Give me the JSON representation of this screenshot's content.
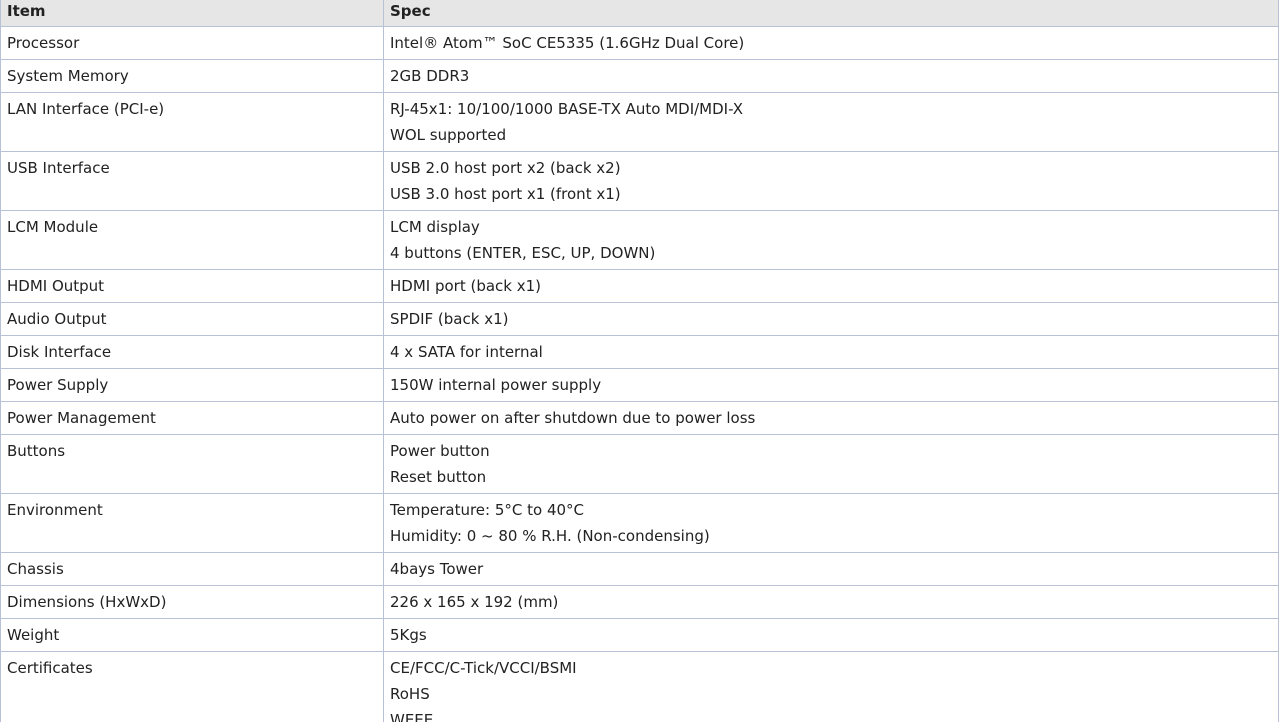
{
  "table": {
    "headers": [
      "Item",
      "Spec"
    ],
    "rows": [
      {
        "item": "Processor",
        "spec": [
          "Intel® Atom™ SoC CE5335 (1.6GHz Dual Core)"
        ]
      },
      {
        "item": "System Memory",
        "spec": [
          "2GB DDR3"
        ]
      },
      {
        "item": "LAN Interface (PCI-e)",
        "spec": [
          "RJ-45x1: 10/100/1000 BASE-TX Auto MDI/MDI-X",
          "WOL supported"
        ]
      },
      {
        "item": "USB Interface",
        "spec": [
          "USB 2.0 host port x2 (back x2)",
          "USB 3.0 host port x1 (front x1)"
        ]
      },
      {
        "item": "LCM Module",
        "spec": [
          "LCM display",
          "4 buttons (ENTER, ESC, UP, DOWN)"
        ]
      },
      {
        "item": "HDMI Output",
        "spec": [
          "HDMI port (back x1)"
        ]
      },
      {
        "item": "Audio Output",
        "spec": [
          "SPDIF (back x1)"
        ]
      },
      {
        "item": "Disk Interface",
        "spec": [
          "4 x SATA for internal"
        ]
      },
      {
        "item": "Power Supply",
        "spec": [
          "150W internal power supply"
        ]
      },
      {
        "item": "Power Management",
        "spec": [
          "Auto power on after shutdown due to power loss"
        ]
      },
      {
        "item": "Buttons",
        "spec": [
          "Power button",
          "Reset button"
        ]
      },
      {
        "item": "Environment",
        "spec": [
          "Temperature: 5°C to 40°C",
          "Humidity: 0 ~ 80 % R.H. (Non-condensing)"
        ]
      },
      {
        "item": "Chassis",
        "spec": [
          "4bays Tower"
        ]
      },
      {
        "item": "Dimensions (HxWxD)",
        "spec": [
          "226 x 165 x 192 (mm)"
        ]
      },
      {
        "item": "Weight",
        "spec": [
          "5Kgs"
        ]
      },
      {
        "item": "Certificates",
        "spec": [
          "CE/FCC/C-Tick/VCCI/BSMI",
          "RoHS",
          "WEEE"
        ]
      }
    ]
  },
  "colors": {
    "border": "#b8c2d6",
    "header_bg": "#e6e6e6"
  }
}
